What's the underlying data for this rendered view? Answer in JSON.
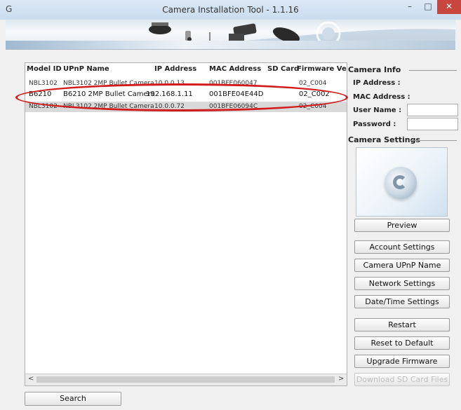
{
  "window": {
    "title": "Camera Installation Tool - 1.1.16",
    "app_icon": "G"
  },
  "table": {
    "headers": [
      "Model ID",
      "UPnP Name",
      "IP Address",
      "MAC Address",
      "SD Card",
      "Firmware Versic"
    ],
    "rows": [
      {
        "model": "NBL3102",
        "upnp": "NBL3102 2MP Bullet Camera",
        "ip": "10.0.0.13",
        "mac": "001BFE060047",
        "sd": "",
        "fw": "02_C004"
      },
      {
        "model": "B6210",
        "upnp": "B6210  2MP Bullet Camera",
        "ip": "192.168.1.11",
        "mac": "001BFE04E44D",
        "sd": "",
        "fw": "02_C002"
      },
      {
        "model": "NBL3102",
        "upnp": "NBL3102 2MP Bullet Camera",
        "ip": "10.0.0.72",
        "mac": "001BFE06094C",
        "sd": "",
        "fw": "02_C004"
      }
    ]
  },
  "camera_info": {
    "title": "Camera Info",
    "ip_label": "IP Address :",
    "mac_label": "MAC Address :",
    "user_label": "User Name :",
    "password_label": "Password :"
  },
  "camera_settings": {
    "title": "Camera Settings",
    "buttons": {
      "preview": "Preview",
      "account": "Account Settings",
      "upnp": "Camera UPnP Name",
      "network": "Network Settings",
      "datetime": "Date/Time Settings",
      "restart": "Restart",
      "reset": "Reset to Default",
      "upgrade": "Upgrade Firmware",
      "download_sd": "Download SD Card Files"
    }
  },
  "search_label": "Search"
}
